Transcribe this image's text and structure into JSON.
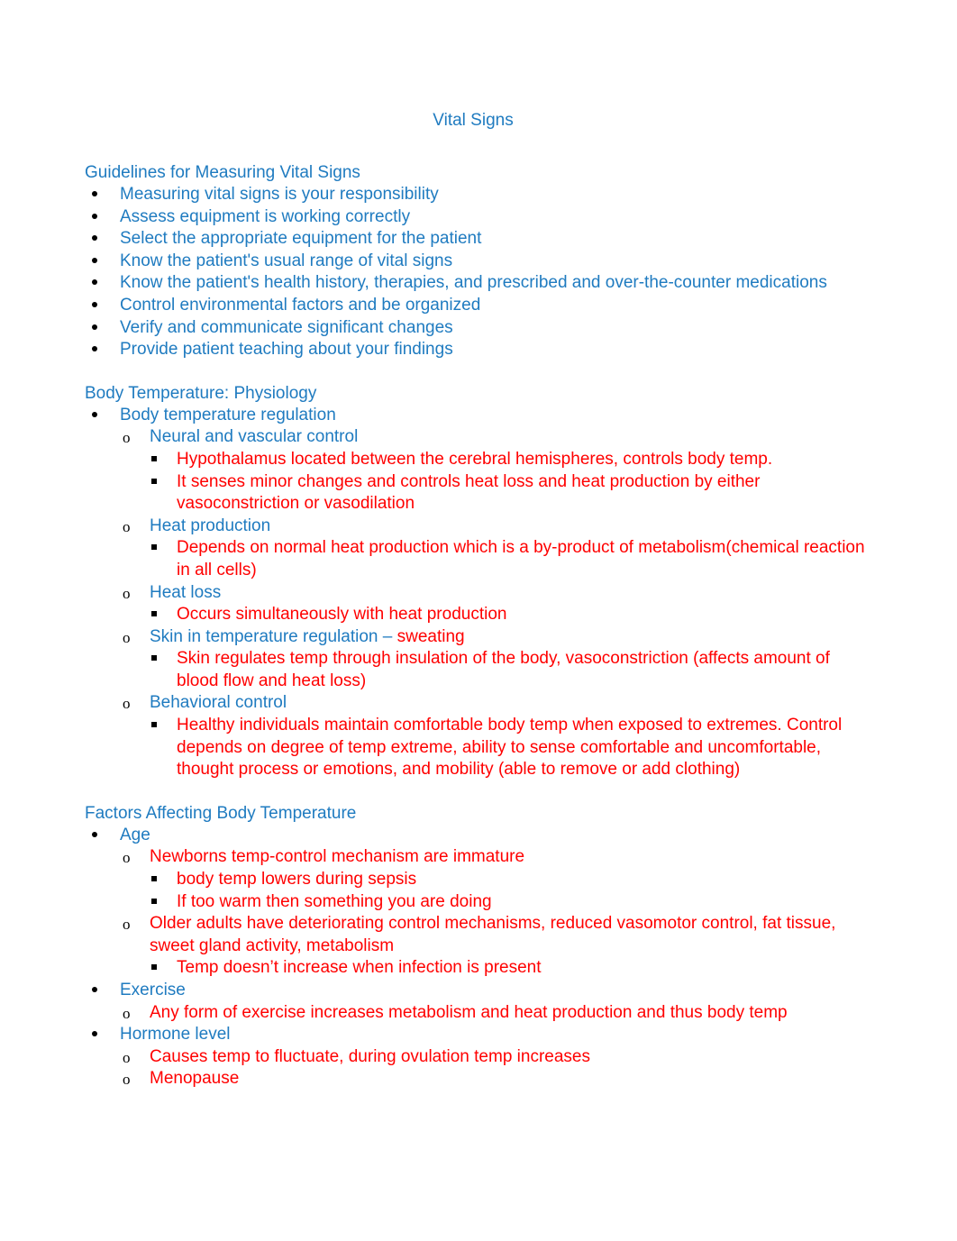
{
  "document": {
    "title": "Vital Signs",
    "title_color": "#1F7BC0",
    "body_blue": "#1F7BC0",
    "body_red": "#FF0000",
    "marker_color": "#000000"
  },
  "markers": {
    "level1": "•",
    "level2": "o",
    "level3": "▪"
  },
  "sections": [
    {
      "heading": "Guidelines for Measuring Vital Signs",
      "items": [
        {
          "text": "Measuring vital signs is your responsibility"
        },
        {
          "text": "Assess equipment is working correctly"
        },
        {
          "text": "Select the appropriate equipment for the patient"
        },
        {
          "text": "Know the patient's usual range of vital signs"
        },
        {
          "text": "Know the patient's health history, therapies, and prescribed and over-the-counter medications"
        },
        {
          "text": "Control environmental factors and be organized"
        },
        {
          "text": "Verify and communicate significant changes"
        },
        {
          "text": "Provide patient teaching about your findings"
        }
      ]
    },
    {
      "heading": "Body Temperature: Physiology",
      "items": [
        {
          "text": "Body temperature regulation"
        },
        {
          "text": "Neural and vascular control"
        },
        {
          "text": "Hypothalamus located between the cerebral hemispheres, controls body temp."
        },
        {
          "text": "It senses minor changes and controls heat loss and heat production by either vasoconstriction or vasodilation"
        },
        {
          "text": "Heat production"
        },
        {
          "text": "Depends on normal heat production which is a by-product of metabolism(chemical reaction in all cells)"
        },
        {
          "text": "Heat loss"
        },
        {
          "text": "Occurs simultaneously with heat production"
        },
        {
          "text_part_blue": "Skin in temperature regulation – ",
          "text_part_red": "sweating"
        },
        {
          "text": "Skin regulates temp through insulation of the body, vasoconstriction (affects amount of blood flow and heat loss)"
        },
        {
          "text": "Behavioral control"
        },
        {
          "text": "Healthy individuals maintain comfortable body temp when exposed to extremes. Control depends on degree of temp extreme, ability to sense comfortable and uncomfortable, thought process or emotions, and mobility (able to remove or add clothing)"
        }
      ]
    },
    {
      "heading": "Factors Affecting Body Temperature",
      "items": [
        {
          "text": "Age"
        },
        {
          "text": "Newborns temp-control mechanism are immature"
        },
        {
          "text": "body temp lowers during sepsis"
        },
        {
          "text": "If too warm then something you are doing"
        },
        {
          "text": "Older adults have deteriorating control mechanisms, reduced vasomotor control, fat tissue, sweet gland activity, metabolism"
        },
        {
          "text": "Temp doesn’t increase when infection is present"
        },
        {
          "text": "Exercise"
        },
        {
          "text": "Any form of exercise increases metabolism and heat production and thus body temp"
        },
        {
          "text": "Hormone level"
        },
        {
          "text": "Causes temp to fluctuate, during ovulation temp increases"
        },
        {
          "text": "Menopause"
        }
      ]
    }
  ]
}
